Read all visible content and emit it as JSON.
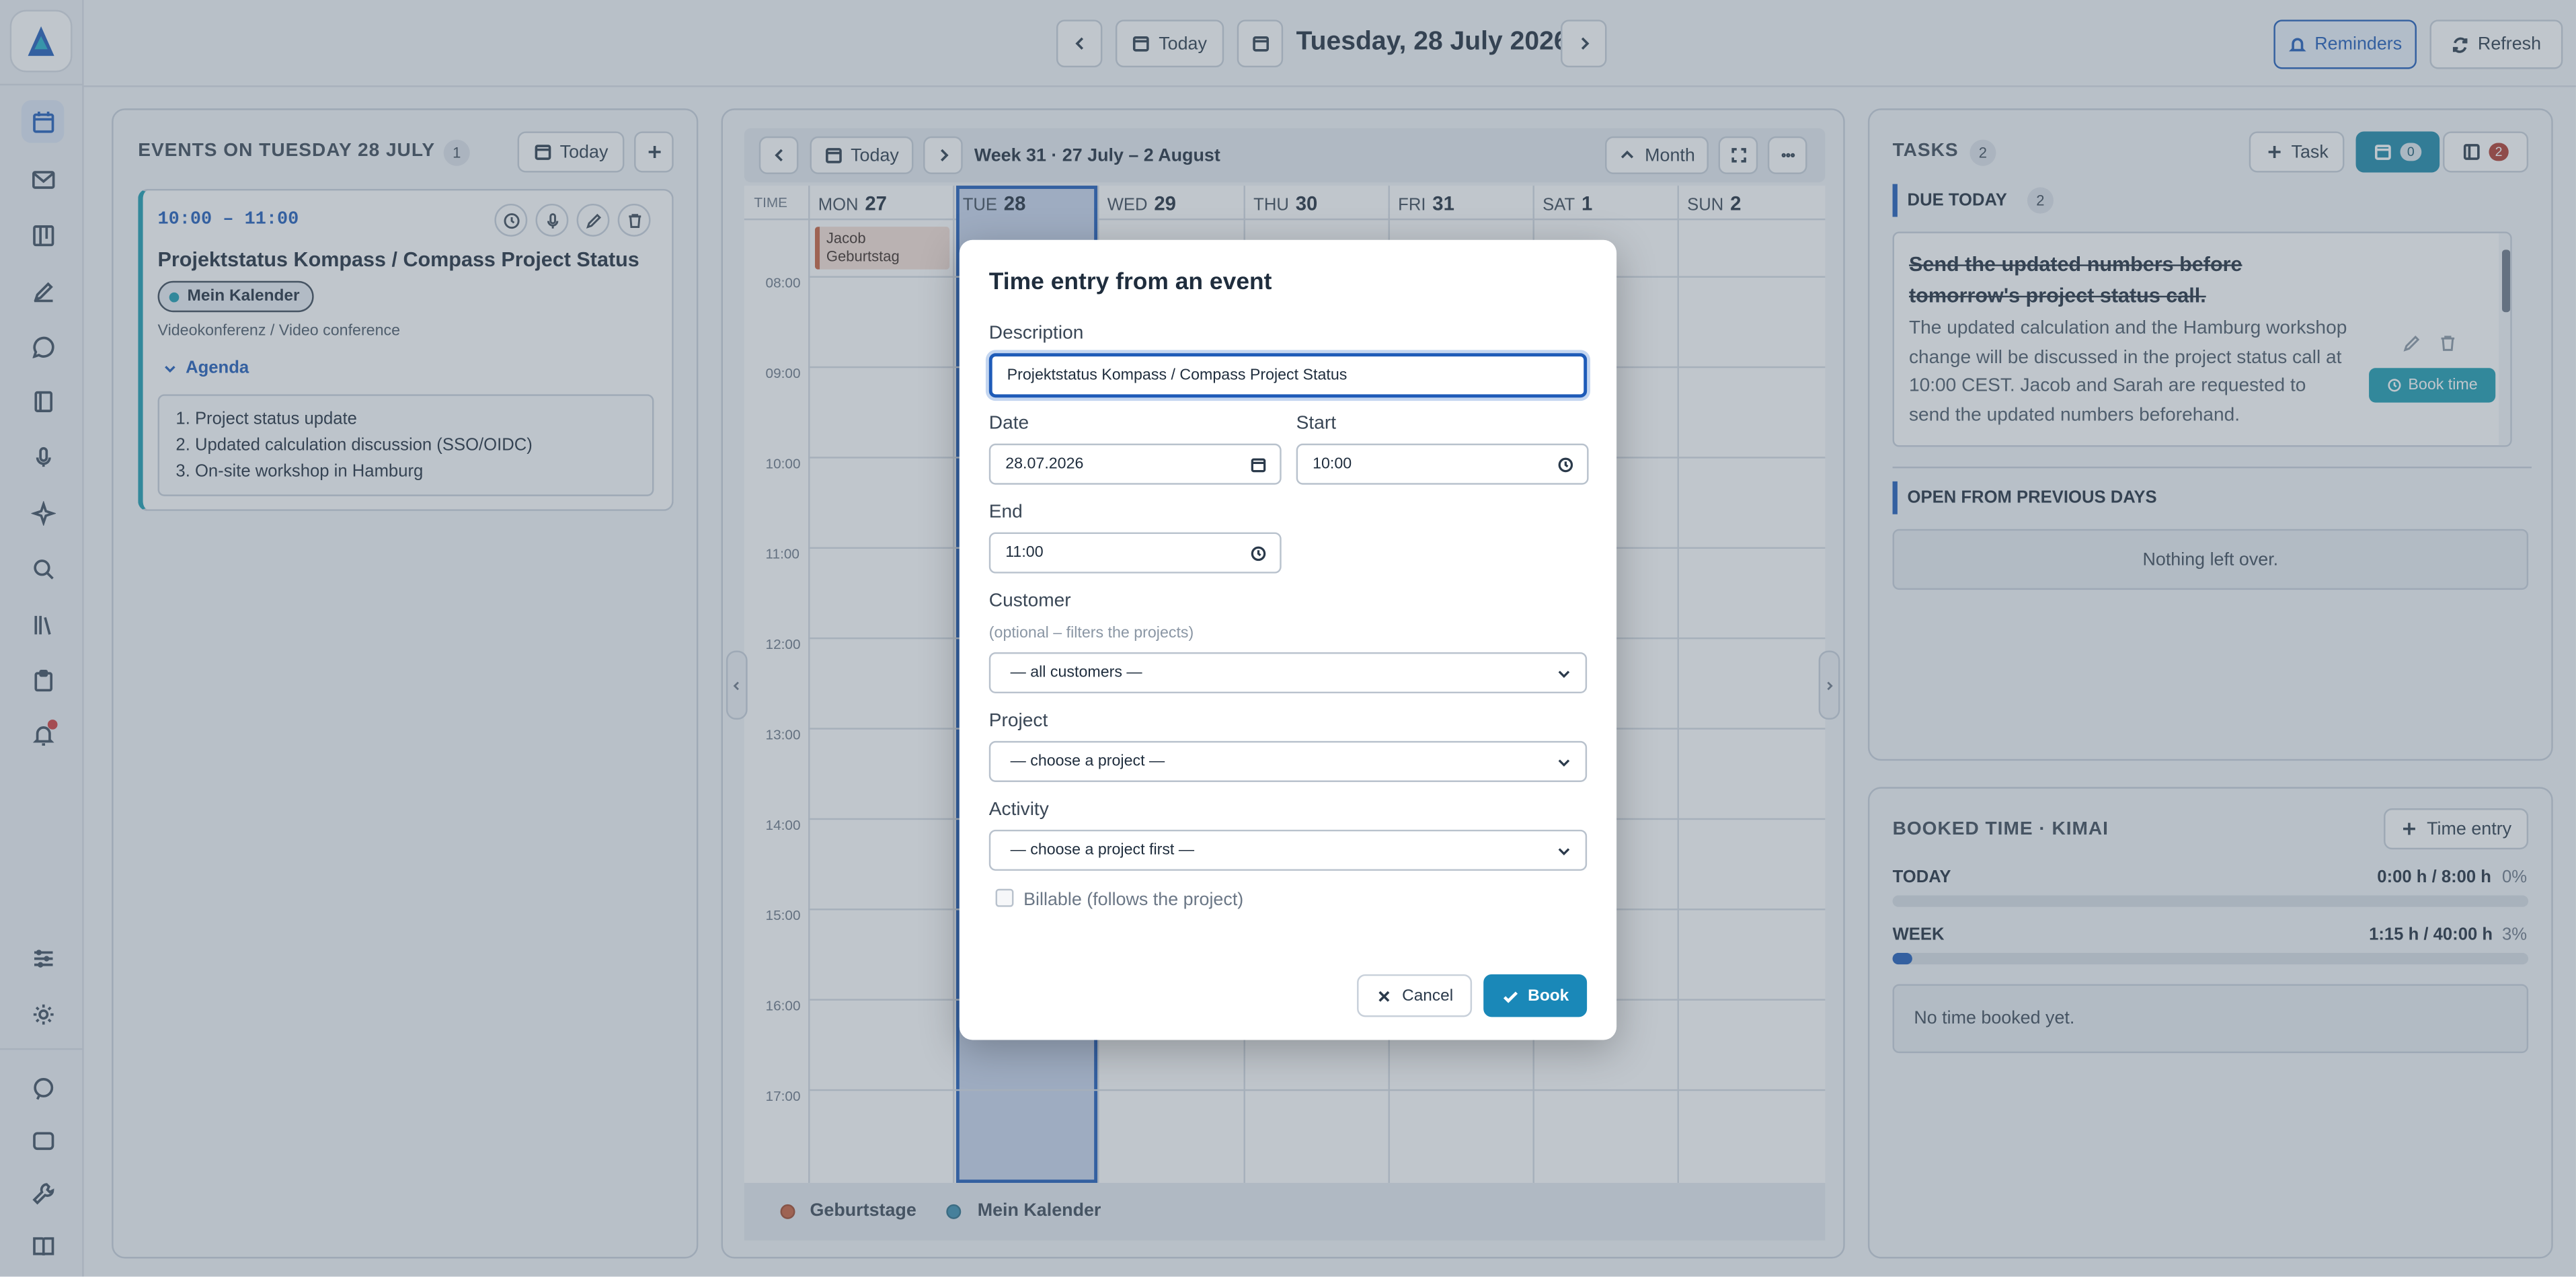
{
  "topbar": {
    "today_label": "Today",
    "date_title": "Tuesday, 28 July 2026",
    "reminders_label": "Reminders",
    "refresh_label": "Refresh"
  },
  "events_panel": {
    "title": "EVENTS ON TUESDAY 28 JULY",
    "count": "1",
    "today_label": "Today",
    "event": {
      "time": "10:00 – 11:00",
      "title": "Projektstatus Kompass / Compass Project Status",
      "calendar": "Mein Kalender",
      "location": "Videokonferenz / Video conference",
      "agenda_label": "Agenda",
      "agenda": [
        "1. Project status update",
        "2. Updated calculation discussion (SSO/OIDC)",
        "3. On-site workshop in Hamburg"
      ]
    }
  },
  "calendar": {
    "today_label": "Today",
    "week_title": "Week 31 · 27 July – 2 August",
    "month_label": "Month",
    "time_header": "TIME",
    "days": [
      {
        "dow": "MON",
        "num": "27"
      },
      {
        "dow": "TUE",
        "num": "28"
      },
      {
        "dow": "WED",
        "num": "29"
      },
      {
        "dow": "THU",
        "num": "30"
      },
      {
        "dow": "FRI",
        "num": "31"
      },
      {
        "dow": "SAT",
        "num": "1"
      },
      {
        "dow": "SUN",
        "num": "2"
      }
    ],
    "hours": [
      "08:00",
      "09:00",
      "10:00",
      "11:00",
      "12:00",
      "13:00",
      "14:00",
      "15:00",
      "16:00",
      "17:00"
    ],
    "birthday_event": "Jacob Geburtstag",
    "legend": [
      {
        "label": "Geburtstage",
        "color": "#c8603c"
      },
      {
        "label": "Mein Kalender",
        "color": "#3a8fb0"
      }
    ]
  },
  "tasks_panel": {
    "title": "TASKS",
    "count": "2",
    "task_button": "Task",
    "cal_badge": "0",
    "list_badge": "2",
    "due_today_label": "DUE TODAY",
    "due_today_count": "2",
    "task_title": "Send the updated numbers before tomorrow's project status call.",
    "task_body": "The updated calculation and the Hamburg workshop change will be discussed in the project status call at 10:00 CEST. Jacob and Sarah are requested to send the updated numbers beforehand.",
    "book_time": "Book time",
    "open_prev_label": "OPEN FROM PREVIOUS DAYS",
    "nothing_left": "Nothing left over."
  },
  "booked_panel": {
    "title": "BOOKED TIME · KIMAI",
    "time_entry_button": "Time entry",
    "today_label": "TODAY",
    "today_value": "0:00 h / 8:00 h",
    "today_pct": "0%",
    "today_fraction": 0,
    "week_label": "WEEK",
    "week_value": "1:15 h / 40:00 h",
    "week_pct": "3%",
    "week_fraction": 0.03,
    "no_time": "No time booked yet."
  },
  "modal": {
    "title": "Time entry from an event",
    "description_label": "Description",
    "description_value": "Projektstatus Kompass / Compass Project Status",
    "date_label": "Date",
    "date_value": "28.07.2026",
    "start_label": "Start",
    "start_value": "10:00",
    "end_label": "End",
    "end_value": "11:00",
    "customer_label": "Customer",
    "customer_hint": "(optional – filters the projects)",
    "customer_value": "— all customers —",
    "project_label": "Project",
    "project_value": "— choose a project —",
    "activity_label": "Activity",
    "activity_value": "— choose a project first —",
    "billable_label": "Billable (follows the project)",
    "cancel_label": "Cancel",
    "book_label": "Book"
  },
  "colors": {
    "accent": "#1e5bb8",
    "teal": "#1a9bb0",
    "selected_day": "#c8d6ee"
  }
}
